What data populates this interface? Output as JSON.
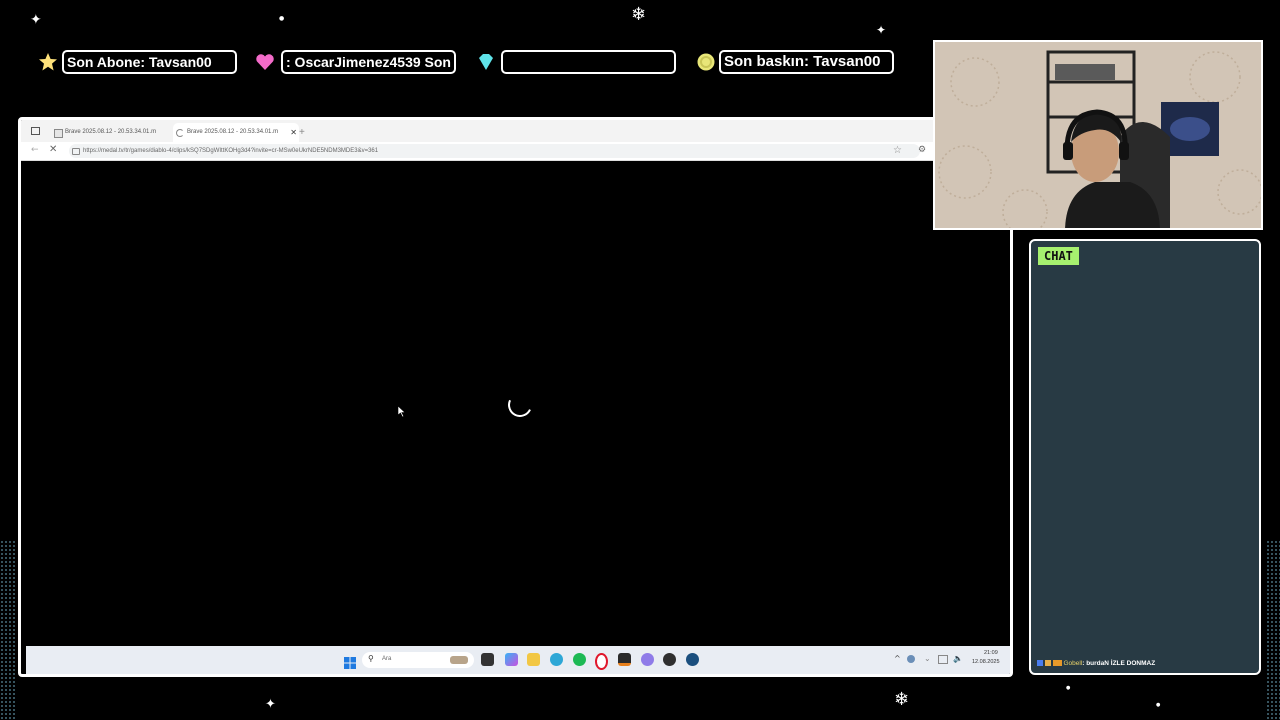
{
  "overlay": {
    "last_sub_label": "Son Abone: Tavsan00",
    "last_follower_label": ": OscarJimenez4539    Son",
    "empty_label": "",
    "last_raid_label": "Son baskın: Tavsan00",
    "icons": [
      "star-icon",
      "heart-icon",
      "diamond-icon",
      "coin-icon"
    ],
    "colors": {
      "star": "#ffe27a",
      "heart": "#f36bc9",
      "diamond": "#5fe3e9",
      "coin": "#e8e678"
    }
  },
  "browser": {
    "tabs": [
      {
        "label": "Brave 2025.08.12 - 20.53.34.01.m"
      },
      {
        "label": "Brave 2025.08.12 - 20.53.34.01.m"
      }
    ],
    "new_tab": "+",
    "url": "https://medal.tv/tr/games/diablo-4/clips/kSQ7SDgWIttKOHg3d4?invite=cr-MSw0eUkrNDE5NDM3MDE3&v=361"
  },
  "taskbar": {
    "search_placeholder": "Ara",
    "time": "21:09",
    "date": "12.08.2025",
    "apps": [
      "windows-start-icon",
      "task-view-icon",
      "copilot-icon",
      "file-explorer-icon",
      "edge-icon",
      "spotify-icon",
      "opera-icon",
      "app-icon",
      "obs-icon",
      "chrome-icon",
      "steam-icon"
    ]
  },
  "chat": {
    "title": "CHAT",
    "message_user": "Gobell",
    "message_text": ": burdaN İZLE DONMAZ"
  }
}
